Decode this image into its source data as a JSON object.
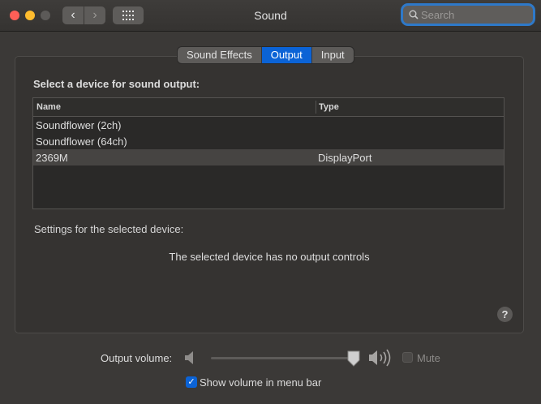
{
  "window": {
    "title": "Sound"
  },
  "search": {
    "placeholder": "Search"
  },
  "tabs": [
    {
      "label": "Sound Effects",
      "active": false
    },
    {
      "label": "Output",
      "active": true
    },
    {
      "label": "Input",
      "active": false
    }
  ],
  "output": {
    "heading": "Select a device for sound output:",
    "columns": [
      "Name",
      "Type"
    ],
    "devices": [
      {
        "name": "Soundflower (2ch)",
        "type": ""
      },
      {
        "name": "Soundflower (64ch)",
        "type": ""
      },
      {
        "name": "2369M",
        "type": "DisplayPort",
        "selected": true
      }
    ],
    "settings_label": "Settings for the selected device:",
    "no_controls_message": "The selected device has no output controls",
    "help_label": "?"
  },
  "footer": {
    "volume_label": "Output volume:",
    "volume_level": 0.95,
    "mute_label": "Mute",
    "mute_checked": false,
    "show_volume_label": "Show volume in menu bar",
    "show_volume_checked": true
  },
  "colors": {
    "accent": "#0b63d6",
    "focus_ring": "#2e79c9",
    "close": "#fe5f57",
    "minimize": "#febc2e"
  }
}
